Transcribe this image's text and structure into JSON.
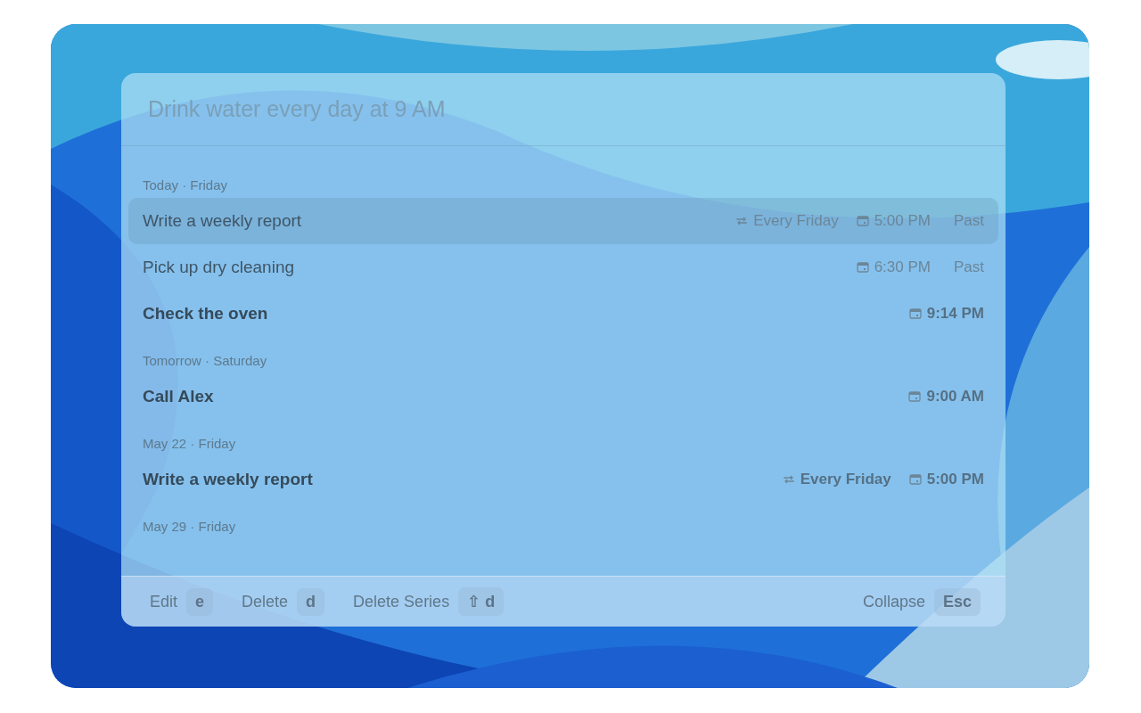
{
  "search": {
    "placeholder": "Drink water every day at 9 AM"
  },
  "sections": [
    {
      "header": "Today · Friday",
      "items": [
        {
          "title": "Write a weekly report",
          "selected": true,
          "past": true,
          "repeat": "Every Friday",
          "time": "5:00 PM",
          "status": "Past"
        },
        {
          "title": "Pick up dry cleaning",
          "selected": false,
          "past": true,
          "time": "6:30 PM",
          "status": "Past"
        },
        {
          "title": "Check the oven",
          "selected": false,
          "past": false,
          "time": "9:14 PM"
        }
      ]
    },
    {
      "header": "Tomorrow · Saturday",
      "items": [
        {
          "title": "Call Alex",
          "selected": false,
          "past": false,
          "time": "9:00 AM"
        }
      ]
    },
    {
      "header": "May 22 · Friday",
      "items": [
        {
          "title": "Write a weekly report",
          "selected": false,
          "past": false,
          "repeat": "Every Friday",
          "time": "5:00 PM"
        }
      ]
    },
    {
      "header": "May 29 · Friday"
    }
  ],
  "footer": {
    "left": [
      {
        "label": "Edit",
        "key": "e"
      },
      {
        "label": "Delete",
        "key": "d"
      },
      {
        "label": "Delete Series",
        "key": "⇧ d"
      }
    ],
    "right": [
      {
        "label": "Collapse",
        "key": "Esc"
      }
    ]
  }
}
